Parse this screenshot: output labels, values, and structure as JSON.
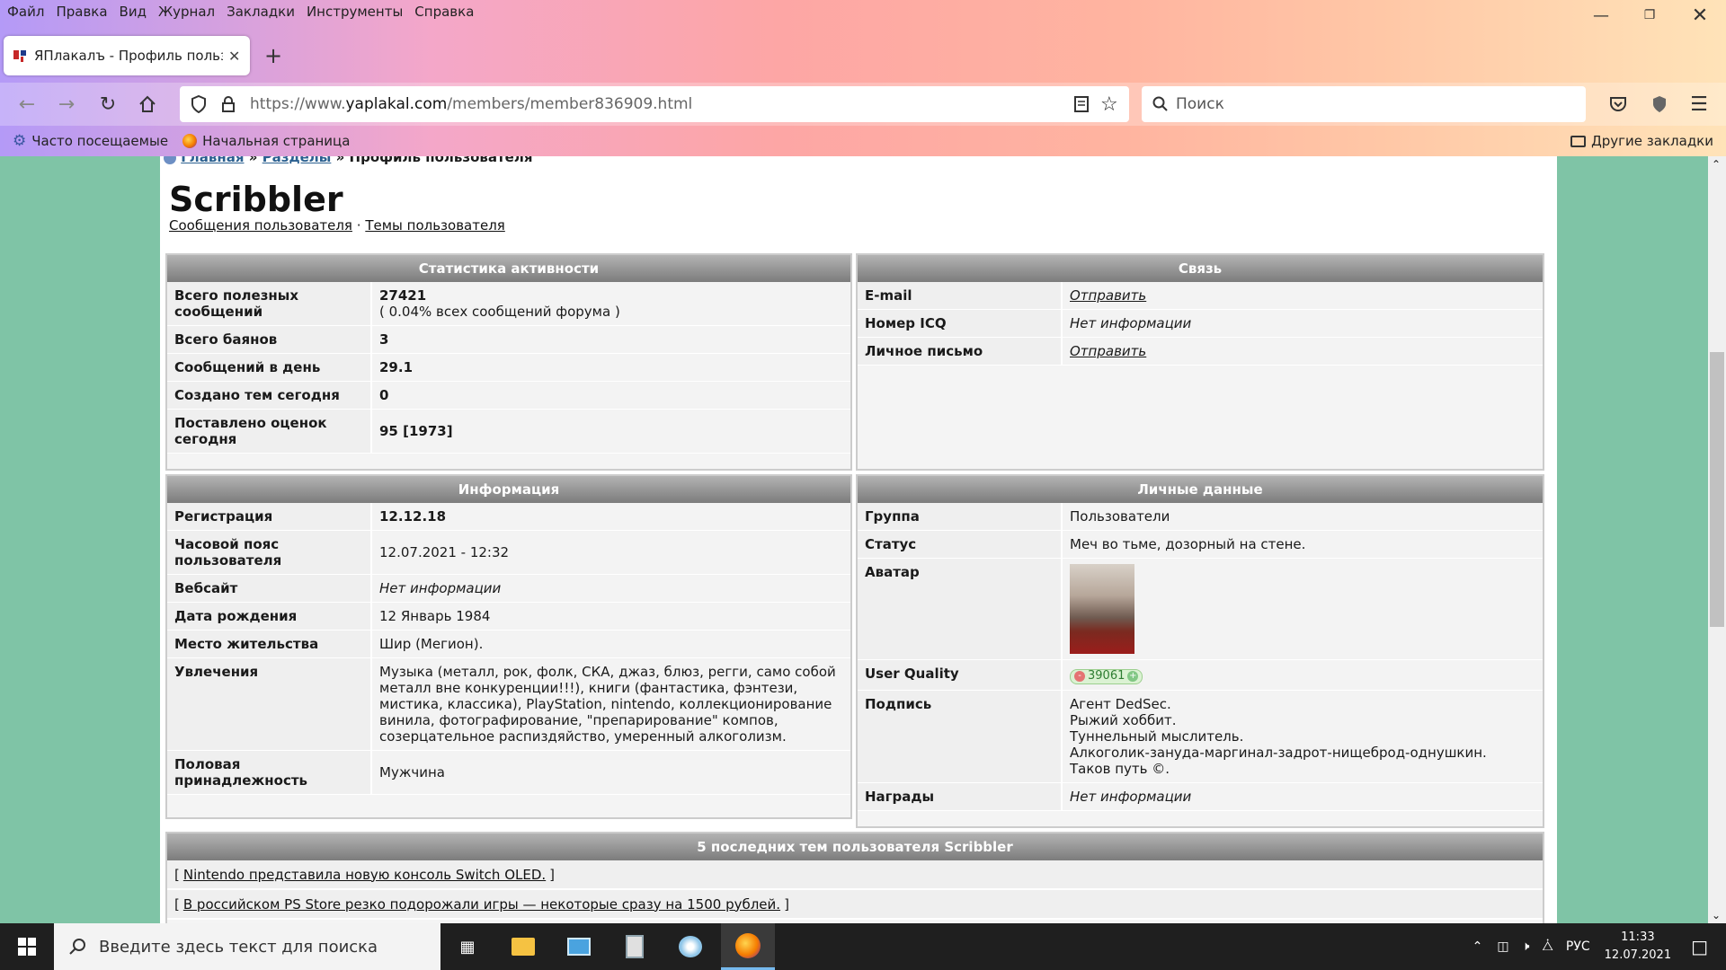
{
  "browser": {
    "menu": [
      "Файл",
      "Правка",
      "Вид",
      "Журнал",
      "Закладки",
      "Инструменты",
      "Справка"
    ],
    "tab_title": "ЯПлакалъ - Профиль пользов",
    "url_host_prefix": "https://www.",
    "url_host": "yaplakal.com",
    "url_path": "/members/member836909.html",
    "search_placeholder": "Поиск",
    "bookmarks": {
      "frequent": "Часто посещаемые",
      "home": "Начальная страница",
      "other": "Другие закладки"
    }
  },
  "page": {
    "breadcrumb": {
      "home": "Главная",
      "sep1": "»",
      "sections": "Разделы",
      "sep2": "»",
      "current": "Профиль пользователя"
    },
    "username": "Scribbler",
    "user_links": {
      "posts": "Сообщения пользователя",
      "sep": "·",
      "topics": "Темы пользователя"
    },
    "activity": {
      "title": "Статистика активности",
      "rows": [
        {
          "label": "Всего полезных сообщений",
          "value": "27421",
          "sub": "( 0.04% всех сообщений форума )"
        },
        {
          "label": "Всего баянов",
          "value": "3"
        },
        {
          "label": "Сообщений в день",
          "value": "29.1"
        },
        {
          "label": "Создано тем сегодня",
          "value": "0"
        },
        {
          "label": "Поставлено оценок сегодня",
          "value": "95 [1973]"
        }
      ]
    },
    "contact": {
      "title": "Связь",
      "rows": [
        {
          "label": "E-mail",
          "value": "Отправить"
        },
        {
          "label": "Номер ICQ",
          "value": "Нет информации"
        },
        {
          "label": "Личное письмо",
          "value": "Отправить"
        }
      ]
    },
    "info": {
      "title": "Информация",
      "rows": [
        {
          "label": "Регистрация",
          "value": "12.12.18"
        },
        {
          "label": "Часовой пояс пользователя",
          "value": "12.07.2021 - 12:32"
        },
        {
          "label": "Вебсайт",
          "value": "Нет информации"
        },
        {
          "label": "Дата рождения",
          "value": "12 Январь 1984"
        },
        {
          "label": "Место жительства",
          "value": "Шир (Мегион)."
        },
        {
          "label": "Увлечения",
          "value": "Музыка (металл, рок, фолк, СКА, джаз, блюз, регги, само собой металл вне конкуренции!!!), книги (фантастика, фэнтези, мистика, классика), PlayStation, nintendo, коллекционирование винила, фотографирование, \"препарирование\" компов, созерцательное распиздяйство, умеренный алкоголизм."
        },
        {
          "label": "Половая принадлежность",
          "value": "Мужчина"
        }
      ]
    },
    "personal": {
      "title": "Личные данные",
      "rows": [
        {
          "label": "Группа",
          "value": "Пользователи"
        },
        {
          "label": "Статус",
          "value": "Меч во тьме, дозорный на стене."
        },
        {
          "label": "Аватар",
          "value": ""
        },
        {
          "label": "User Quality",
          "value": "39061",
          "minus": "-",
          "plus": "+"
        },
        {
          "label": "Подпись",
          "lines": [
            "Агент DedSec.",
            "Рыжий хоббит.",
            "Туннельный мыслитель.",
            "Алкоголик-зануда-маргинал-задрот-нищеброд-однушкин.",
            "Таков путь ©."
          ]
        },
        {
          "label": "Награды",
          "value": "Нет информации"
        }
      ]
    },
    "topics": {
      "title": "5 последних тем пользователя Scribbler",
      "bracket_open": "[",
      "bracket_close": "]",
      "items": [
        "Nintendo представила новую консоль Switch OLED.",
        "В российском PS Store резко подорожали игры — некоторые сразу на 1500 рублей."
      ]
    }
  },
  "taskbar": {
    "search_placeholder": "Введите здесь текст для поиска",
    "lang": "РУС",
    "time": "11:33",
    "date": "12.07.2021"
  },
  "colors": {
    "panel_header": "#8a8a8a",
    "page_bg": "#7fc4a6",
    "link": "#2b6090"
  }
}
